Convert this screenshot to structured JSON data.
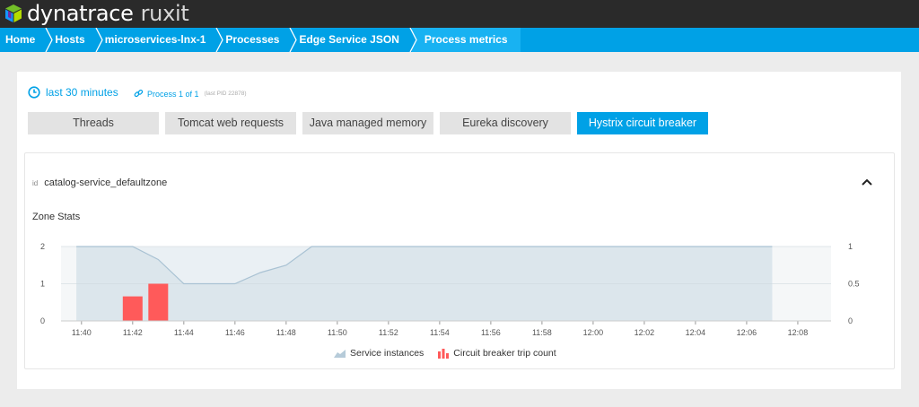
{
  "brand": {
    "name": "dynatrace",
    "product": "ruxit"
  },
  "breadcrumb": [
    "Home",
    "Hosts",
    "microservices-lnx-1",
    "Processes",
    "Edge Service JSON",
    "Process metrics"
  ],
  "filters": {
    "timeframe": "last 30 minutes",
    "process": "Process 1 of 1",
    "process_sub": "(last PID 22878)"
  },
  "tabs": [
    {
      "label": "Threads",
      "active": false
    },
    {
      "label": "Tomcat web requests",
      "active": false
    },
    {
      "label": "Java managed memory",
      "active": false
    },
    {
      "label": "Eureka discovery",
      "active": false
    },
    {
      "label": "Hystrix circuit breaker",
      "active": true
    }
  ],
  "panel": {
    "id_key": "id",
    "id_value": "catalog-service_defaultzone",
    "section_title": "Zone Stats"
  },
  "chart_data": {
    "type": "area",
    "x_ticks": [
      "11:40",
      "11:42",
      "11:44",
      "11:46",
      "11:48",
      "11:50",
      "11:52",
      "11:54",
      "11:56",
      "11:58",
      "12:00",
      "12:02",
      "12:04",
      "12:06",
      "12:08"
    ],
    "y_left_ticks": [
      "0",
      "1",
      "2"
    ],
    "y_right_ticks": [
      "0",
      "0.5",
      "1"
    ],
    "ylim_left": [
      0,
      2
    ],
    "ylim_right": [
      0,
      1
    ],
    "data_range": [
      "11:39.8",
      "12:07"
    ],
    "series": [
      {
        "name": "Service instances",
        "kind": "area",
        "axis": "left",
        "color": "#b6cbd9",
        "points": [
          [
            "11:39.8",
            2
          ],
          [
            "11:42",
            2
          ],
          [
            "11:43",
            1.65
          ],
          [
            "11:44",
            1
          ],
          [
            "11:46",
            1
          ],
          [
            "11:47",
            1.3
          ],
          [
            "11:48",
            1.5
          ],
          [
            "11:49",
            2
          ],
          [
            "12:07",
            2
          ]
        ]
      },
      {
        "name": "Circuit breaker trip count",
        "kind": "bar",
        "axis": "right",
        "color": "#ff5a5a",
        "points": [
          [
            "11:42",
            0.33
          ],
          [
            "11:43",
            0.5
          ]
        ]
      }
    ],
    "legend_position": "bottom"
  }
}
